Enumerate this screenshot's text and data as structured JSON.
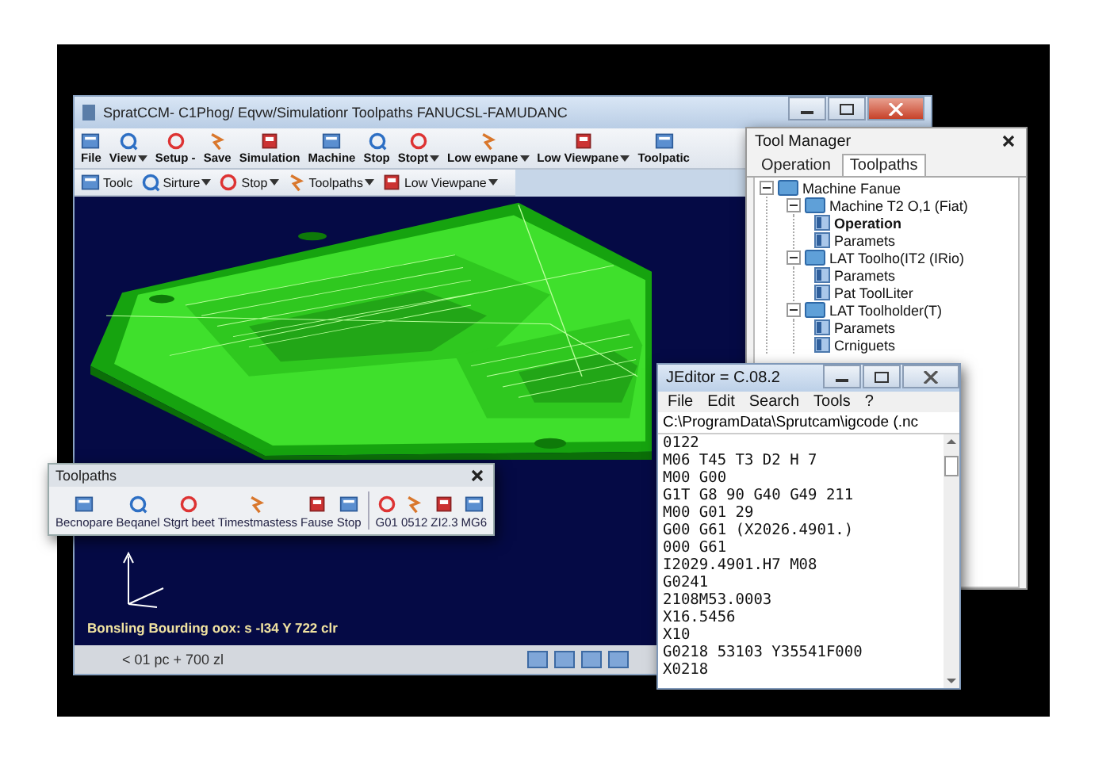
{
  "main_window": {
    "title": "SpratCCM- C1Phog/ Eqvw/Simulationr Toolpaths FANUCSL-FAMUDANC",
    "toolbar_row_1": [
      {
        "label": "File",
        "dropdown": false
      },
      {
        "label": "View",
        "dropdown": true
      },
      {
        "label": "Setup -",
        "dropdown": false
      },
      {
        "label": "Save",
        "dropdown": false
      },
      {
        "label": "Simulation",
        "dropdown": false
      },
      {
        "label": "Machine",
        "dropdown": false
      },
      {
        "label": "Stop",
        "dropdown": false
      },
      {
        "label": "Stopt",
        "dropdown": true
      },
      {
        "label": "Low ewpane",
        "dropdown": true
      },
      {
        "label": "Low Viewpane",
        "dropdown": true
      },
      {
        "label": "Toolpatic",
        "dropdown": false
      }
    ],
    "toolbar_row_2": [
      {
        "label": "Toolc",
        "dropdown": false
      },
      {
        "label": "Sirture",
        "dropdown": true
      },
      {
        "label": "Stop",
        "dropdown": true
      },
      {
        "label": "Toolpaths",
        "dropdown": true
      },
      {
        "label": "Low Viewpane",
        "dropdown": true
      }
    ],
    "viewport_info": "Bonsling Bourding oox: s -I34 Y 722 clr",
    "status_bar": "< 01 pc + 700 zl"
  },
  "toolpaths_toolbar": {
    "title": "Toolpaths",
    "buttons": [
      "Becnopare",
      "Beqanel",
      "Stgrt beet",
      "Timestmastess",
      "Fause",
      "Stop"
    ],
    "codes": [
      "G01",
      "0512",
      "ZI2.3",
      "MG6"
    ]
  },
  "tool_manager": {
    "title": "Tool Manager",
    "tabs": [
      {
        "label": "Operation",
        "selected": false
      },
      {
        "label": "Toolpaths",
        "selected": true
      }
    ],
    "tree": [
      {
        "label": "Machine Fanue",
        "expanded": true,
        "children": [
          {
            "label": "Machine T2 O,1 (Fiat)",
            "expanded": true,
            "children": [
              {
                "label": "Operation",
                "selected": true
              },
              {
                "label": "Paramets",
                "selected": false
              }
            ]
          },
          {
            "label": "LAT Toolho(IT2 (IRio)",
            "expanded": true,
            "children": [
              {
                "label": "Paramets",
                "selected": false
              },
              {
                "label": "Pat ToolLiter",
                "selected": false
              }
            ]
          },
          {
            "label": "LAT Toolholder(T)",
            "expanded": true,
            "children": [
              {
                "label": "Paramets",
                "selected": false
              },
              {
                "label": "Crniguets",
                "selected": false
              }
            ]
          }
        ]
      }
    ]
  },
  "editor": {
    "title": "JEditor = C.08.2",
    "menu": [
      "File",
      "Edit",
      "Search",
      "Tools",
      "?"
    ],
    "path": "C:\\ProgramData\\Sprutcam\\igcode (.nc",
    "lines": [
      "0122",
      "M06 T45 T3 D2 H 7",
      "M00 G00",
      "G1T G8 90 G40 G49 211",
      "M00 G01 29",
      "G00 G61 (X2026.4901.)",
      "000 G61",
      "I2029.4901.H7 M08",
      "G0241",
      "2108M53.0003",
      "X16.5456",
      "X10",
      "G0218 53103 Y35541F000",
      "X0218"
    ]
  }
}
